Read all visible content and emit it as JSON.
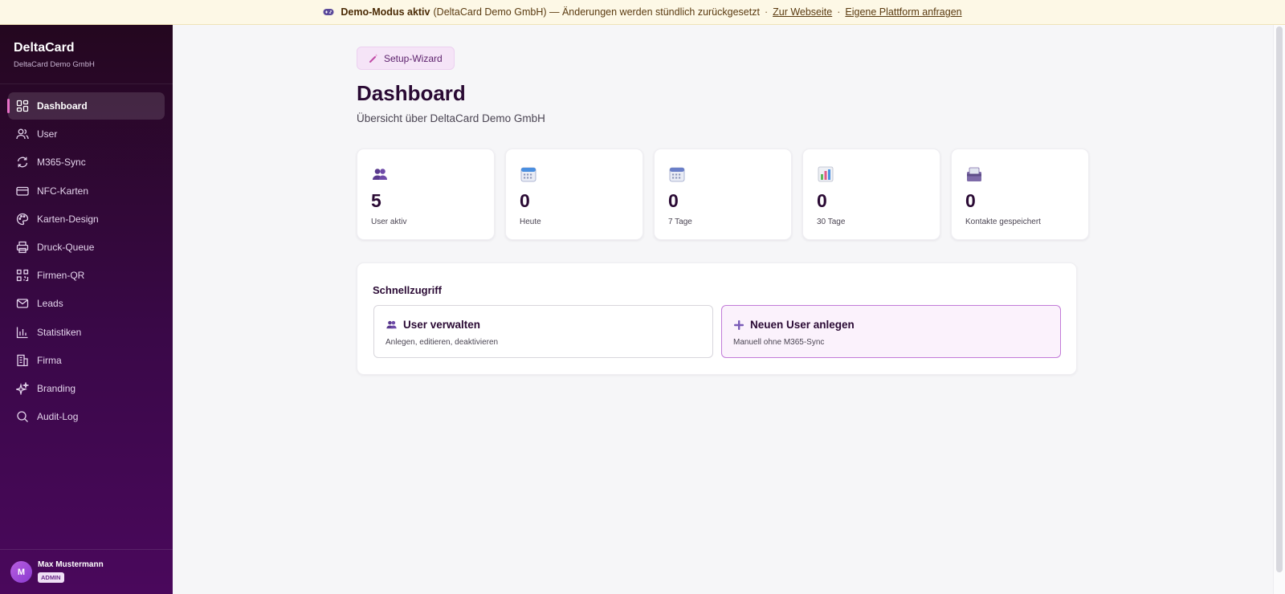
{
  "banner": {
    "strong": "Demo-Modus aktiv",
    "text": "(DeltaCard Demo GmbH) — Änderungen werden stündlich zurückgesetzt",
    "sep": "·",
    "link1": "Zur Webseite",
    "link2": "Eigene Plattform anfragen",
    "icon": "gamepad-icon"
  },
  "brand": {
    "title": "DeltaCard",
    "subtitle": "DeltaCard Demo GmbH"
  },
  "sidebar": {
    "items": [
      {
        "label": "Dashboard",
        "icon": "dashboard-icon",
        "active": true
      },
      {
        "label": "User",
        "icon": "users-icon"
      },
      {
        "label": "M365-Sync",
        "icon": "sync-icon"
      },
      {
        "label": "NFC-Karten",
        "icon": "card-icon"
      },
      {
        "label": "Karten-Design",
        "icon": "palette-icon"
      },
      {
        "label": "Druck-Queue",
        "icon": "printer-icon"
      },
      {
        "label": "Firmen-QR",
        "icon": "qr-icon"
      },
      {
        "label": "Leads",
        "icon": "mail-icon"
      },
      {
        "label": "Statistiken",
        "icon": "chart-icon"
      },
      {
        "label": "Firma",
        "icon": "building-icon"
      },
      {
        "label": "Branding",
        "icon": "sparkle-icon"
      },
      {
        "label": "Audit-Log",
        "icon": "search-icon"
      }
    ]
  },
  "user": {
    "initial": "M",
    "name": "Max Mustermann",
    "role": "ADMIN"
  },
  "main": {
    "wizard_label": "Setup-Wizard",
    "title": "Dashboard",
    "subtitle": "Übersicht über DeltaCard Demo GmbH"
  },
  "stats": [
    {
      "value": "5",
      "label": "User aktiv",
      "icon": "users-emoji-icon"
    },
    {
      "value": "0",
      "label": "Heute",
      "icon": "calendar-icon"
    },
    {
      "value": "0",
      "label": "7 Tage",
      "icon": "calendar-icon"
    },
    {
      "value": "0",
      "label": "30 Tage",
      "icon": "bar-chart-icon"
    },
    {
      "value": "0",
      "label": "Kontakte gespeichert",
      "icon": "card-box-icon"
    }
  ],
  "quick": {
    "title": "Schnellzugriff",
    "actions": [
      {
        "title": "User verwalten",
        "desc": "Anlegen, editieren, deaktivieren"
      },
      {
        "title": "Neuen User anlegen",
        "desc": "Manuell ohne M365-Sync"
      }
    ]
  },
  "colors": {
    "accent": "#c27bd8",
    "sidebar_top": "#24071f",
    "sidebar_bottom": "#4a085c",
    "active_indicator": "#e86fc8"
  }
}
